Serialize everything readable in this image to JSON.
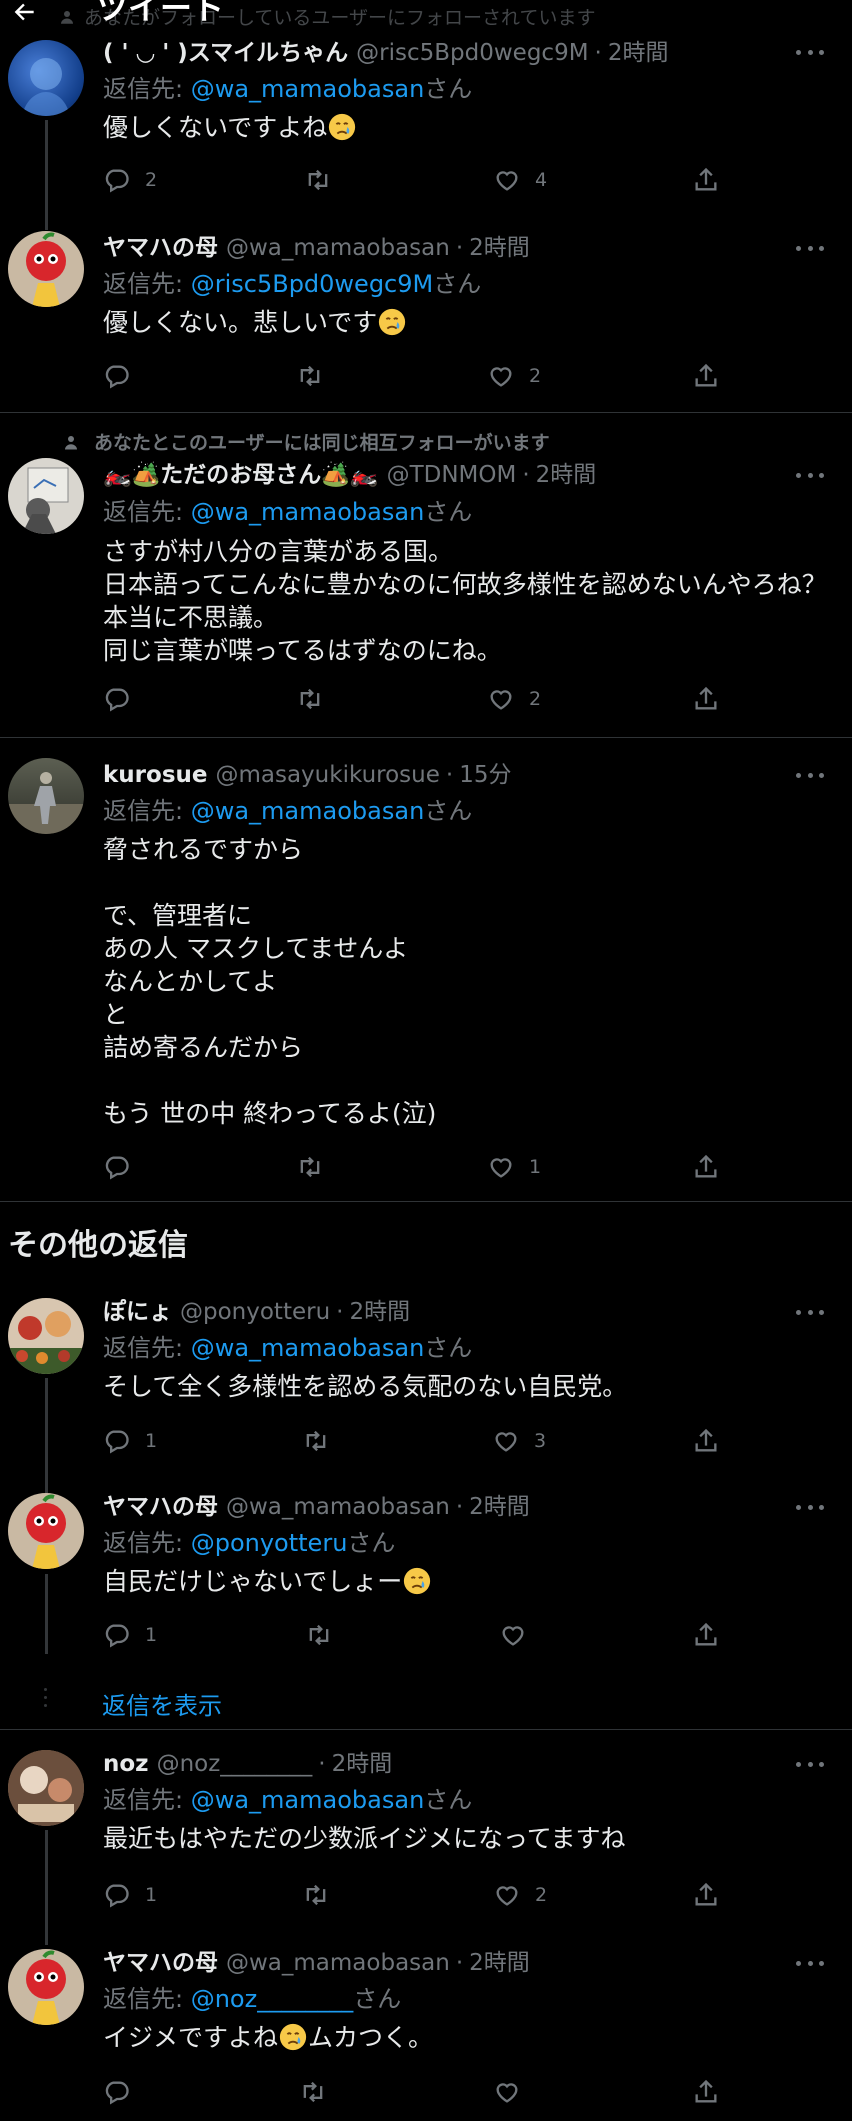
{
  "header": {
    "title": "ツイート",
    "social_context": "あなたがフォローしているユーザーにフォローされています"
  },
  "tweets": [
    {
      "name": "( ' ◡ ' )スマイルちゃん",
      "handle": "@risc5Bpd0wegc9M",
      "time": "2時間",
      "reply_prefix": "返信先: ",
      "reply_to": "@wa_mamaobasan",
      "reply_suffix": "さん",
      "text": "優しくないですよね",
      "replies": "2",
      "retweets": "",
      "likes": "4"
    },
    {
      "name": "ヤマハの母",
      "handle": "@wa_mamaobasan",
      "time": "2時間",
      "reply_prefix": "返信先: ",
      "reply_to": "@risc5Bpd0wegc9M",
      "reply_suffix": "さん",
      "text": "優しくない。悲しいです",
      "replies": "",
      "retweets": "",
      "likes": "2"
    },
    {
      "social_context": "あなたとこのユーザーには同じ相互フォローがいます",
      "name": "🏍️🏕️ただのお母さん🏕️🏍️",
      "handle": "@TDNMOM",
      "time": "2時間",
      "reply_prefix": "返信先: ",
      "reply_to": "@wa_mamaobasan",
      "reply_suffix": "さん",
      "text": "さすが村八分の言葉がある国。\n日本語ってこんなに豊かなのに何故多様性を認めないんやろね？\n本当に不思議。\n同じ言葉が喋ってるはずなのにね。",
      "replies": "",
      "retweets": "",
      "likes": "2"
    },
    {
      "name": "kurosue",
      "handle": "@masayukikurosue",
      "time": "15分",
      "reply_prefix": "返信先: ",
      "reply_to": "@wa_mamaobasan",
      "reply_suffix": "さん",
      "text": "脅されるですから\n\nで、管理者に\nあの人 マスクしてませんよ\nなんとかしてよ\nと\n詰め寄るんだから\n\nもう 世の中 終わってるよ(泣)",
      "replies": "",
      "retweets": "",
      "likes": "1"
    }
  ],
  "other_replies_title": "その他の返信",
  "other": [
    {
      "name": "ぽにょ",
      "handle": "@ponyotteru",
      "time": "2時間",
      "reply_prefix": "返信先: ",
      "reply_to": "@wa_mamaobasan",
      "reply_suffix": "さん",
      "text": "そして全く多様性を認める気配のない自民党。",
      "replies": "1",
      "retweets": "",
      "likes": "3"
    },
    {
      "name": "ヤマハの母",
      "handle": "@wa_mamaobasan",
      "time": "2時間",
      "reply_prefix": "返信先: ",
      "reply_to": "@ponyotteru",
      "reply_suffix": "さん",
      "text": "自民だけじゃないでしょー",
      "replies": "1",
      "retweets": "",
      "likes": ""
    },
    {
      "name": "noz",
      "handle": "@noz________",
      "time": "2時間",
      "reply_prefix": "返信先: ",
      "reply_to": "@wa_mamaobasan",
      "reply_suffix": "さん",
      "text": "最近もはやただの少数派イジメになってますね",
      "replies": "1",
      "retweets": "",
      "likes": "2"
    },
    {
      "name": "ヤマハの母",
      "handle": "@wa_mamaobasan",
      "time": "2時間",
      "reply_prefix": "返信先: ",
      "reply_to": "@noz________",
      "reply_suffix": "さん",
      "text_before": "イジメですよね",
      "text_after": "ムカつく。",
      "replies": "",
      "retweets": "",
      "likes": ""
    }
  ],
  "show_replies": "返信を表示",
  "colors": {
    "accent": "#1d9bf0",
    "muted": "#71767b",
    "border": "#2f3336"
  }
}
